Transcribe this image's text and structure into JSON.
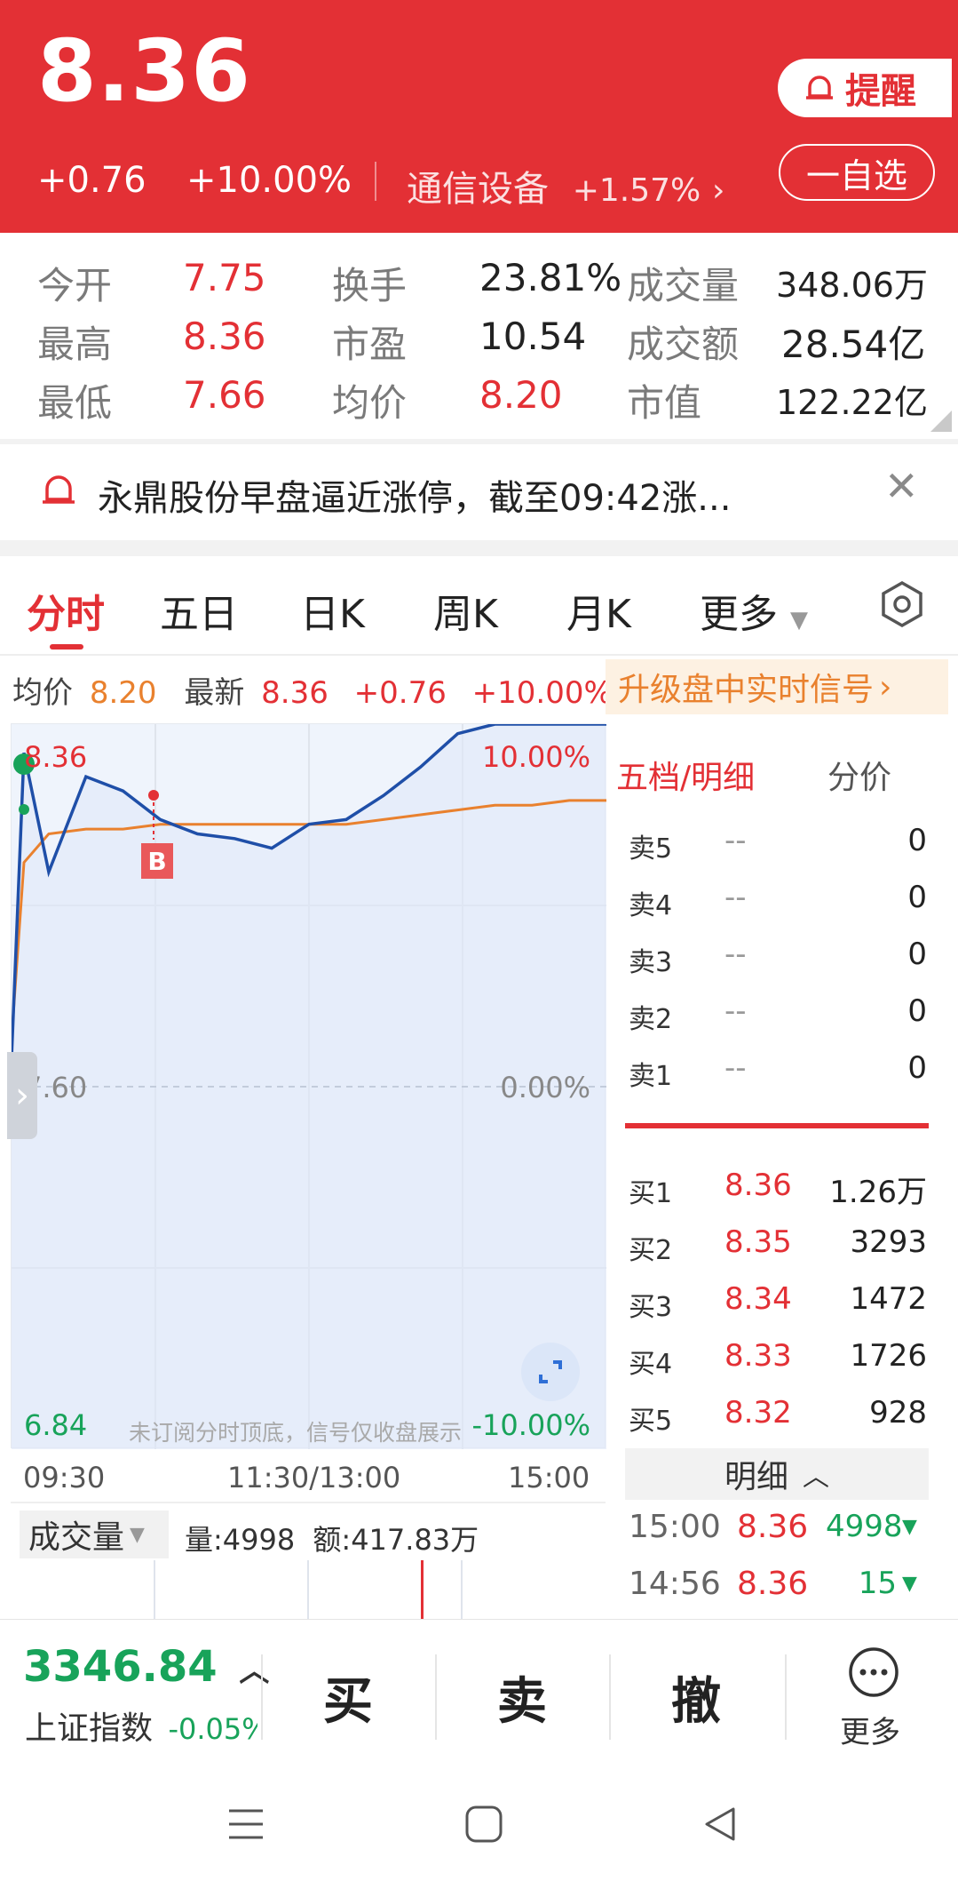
{
  "header": {
    "price": "8.36",
    "change": "+0.76",
    "change_pct": "+10.00%",
    "sector": "通信设备",
    "sector_change": "+1.57%",
    "remind_label": "提醒",
    "watch_label": "一自选"
  },
  "stats": {
    "row1": {
      "l1": "今开",
      "v1": "7.75",
      "l2": "换手",
      "v2": "23.81%",
      "l3": "成交量",
      "v3": "348.06万"
    },
    "row2": {
      "l1": "最高",
      "v1": "8.36",
      "l2": "市盈",
      "v2": "10.54",
      "l3": "成交额",
      "v3": "28.54亿"
    },
    "row3": {
      "l1": "最低",
      "v1": "7.66",
      "l2": "均价",
      "v2": "8.20",
      "l3": "市值",
      "v3": "122.22亿"
    }
  },
  "news": {
    "text": "永鼎股份早盘逼近涨停，截至09:42涨..."
  },
  "tabs": [
    "分时",
    "五日",
    "日K",
    "周K",
    "月K",
    "更多"
  ],
  "info_bar": {
    "avg_label": "均价",
    "avg_value": "8.20",
    "latest_label": "最新",
    "latest_value": "8.36",
    "change": "+0.76",
    "change_pct": "+10.00%",
    "upgrade": "升级盘中实时信号"
  },
  "chart": {
    "top_price": "8.36",
    "top_pct": "10.00%",
    "mid_price": "7.60",
    "mid_pct": "0.00%",
    "bottom_price": "6.84",
    "bottom_pct": "-10.00%",
    "watermark": "未订阅分时顶底，信号仅收盘展示",
    "times": [
      "09:30",
      "11:30/13:00",
      "15:00"
    ],
    "marker": "B"
  },
  "chart_data": {
    "type": "line",
    "xlabel": "",
    "ylabel": "",
    "ylim": [
      6.84,
      8.36
    ],
    "x": [
      "09:30",
      "09:35",
      "09:45",
      "10:00",
      "10:15",
      "10:30",
      "10:45",
      "11:00",
      "11:15",
      "11:30",
      "13:15",
      "13:30",
      "13:45",
      "14:00",
      "14:15",
      "14:30",
      "14:45",
      "15:00"
    ],
    "series": [
      {
        "values": [
          7.66,
          8.3,
          8.05,
          8.25,
          8.22,
          8.16,
          8.13,
          8.12,
          8.1,
          8.15,
          8.16,
          8.21,
          8.27,
          8.34,
          8.36,
          8.36,
          8.36,
          8.36
        ]
      },
      {
        "values": [
          7.7,
          8.07,
          8.13,
          8.14,
          8.14,
          8.15,
          8.15,
          8.15,
          8.15,
          8.15,
          8.15,
          8.16,
          8.17,
          8.18,
          8.19,
          8.19,
          8.2,
          8.2
        ]
      }
    ]
  },
  "volume": {
    "label": "成交量",
    "qty": "量:4998",
    "amount": "额:417.83万"
  },
  "orderbook": {
    "tab1": "五档/明细",
    "tab2": "分价",
    "asks": [
      {
        "label": "卖5",
        "price": "--",
        "vol": "0"
      },
      {
        "label": "卖4",
        "price": "--",
        "vol": "0"
      },
      {
        "label": "卖3",
        "price": "--",
        "vol": "0"
      },
      {
        "label": "卖2",
        "price": "--",
        "vol": "0"
      },
      {
        "label": "卖1",
        "price": "--",
        "vol": "0"
      }
    ],
    "bids": [
      {
        "label": "买1",
        "price": "8.36",
        "vol": "1.26万"
      },
      {
        "label": "买2",
        "price": "8.35",
        "vol": "3293"
      },
      {
        "label": "买3",
        "price": "8.34",
        "vol": "1472"
      },
      {
        "label": "买4",
        "price": "8.33",
        "vol": "1726"
      },
      {
        "label": "买5",
        "price": "8.32",
        "vol": "928"
      }
    ],
    "detail_label": "明细",
    "ticks": [
      {
        "time": "15:00",
        "price": "8.36",
        "vol": "4998"
      },
      {
        "time": "14:56",
        "price": "8.36",
        "vol": "15"
      }
    ]
  },
  "bottom": {
    "index_value": "3346.84",
    "index_name": "上证指数",
    "index_change": "-0.05%",
    "buy": "买",
    "sell": "卖",
    "cancel": "撤",
    "more": "更多"
  },
  "colors": {
    "brand_red": "#e33035",
    "green": "#18a35a",
    "orange": "#e9812e",
    "blue": "#1f4fa8"
  }
}
